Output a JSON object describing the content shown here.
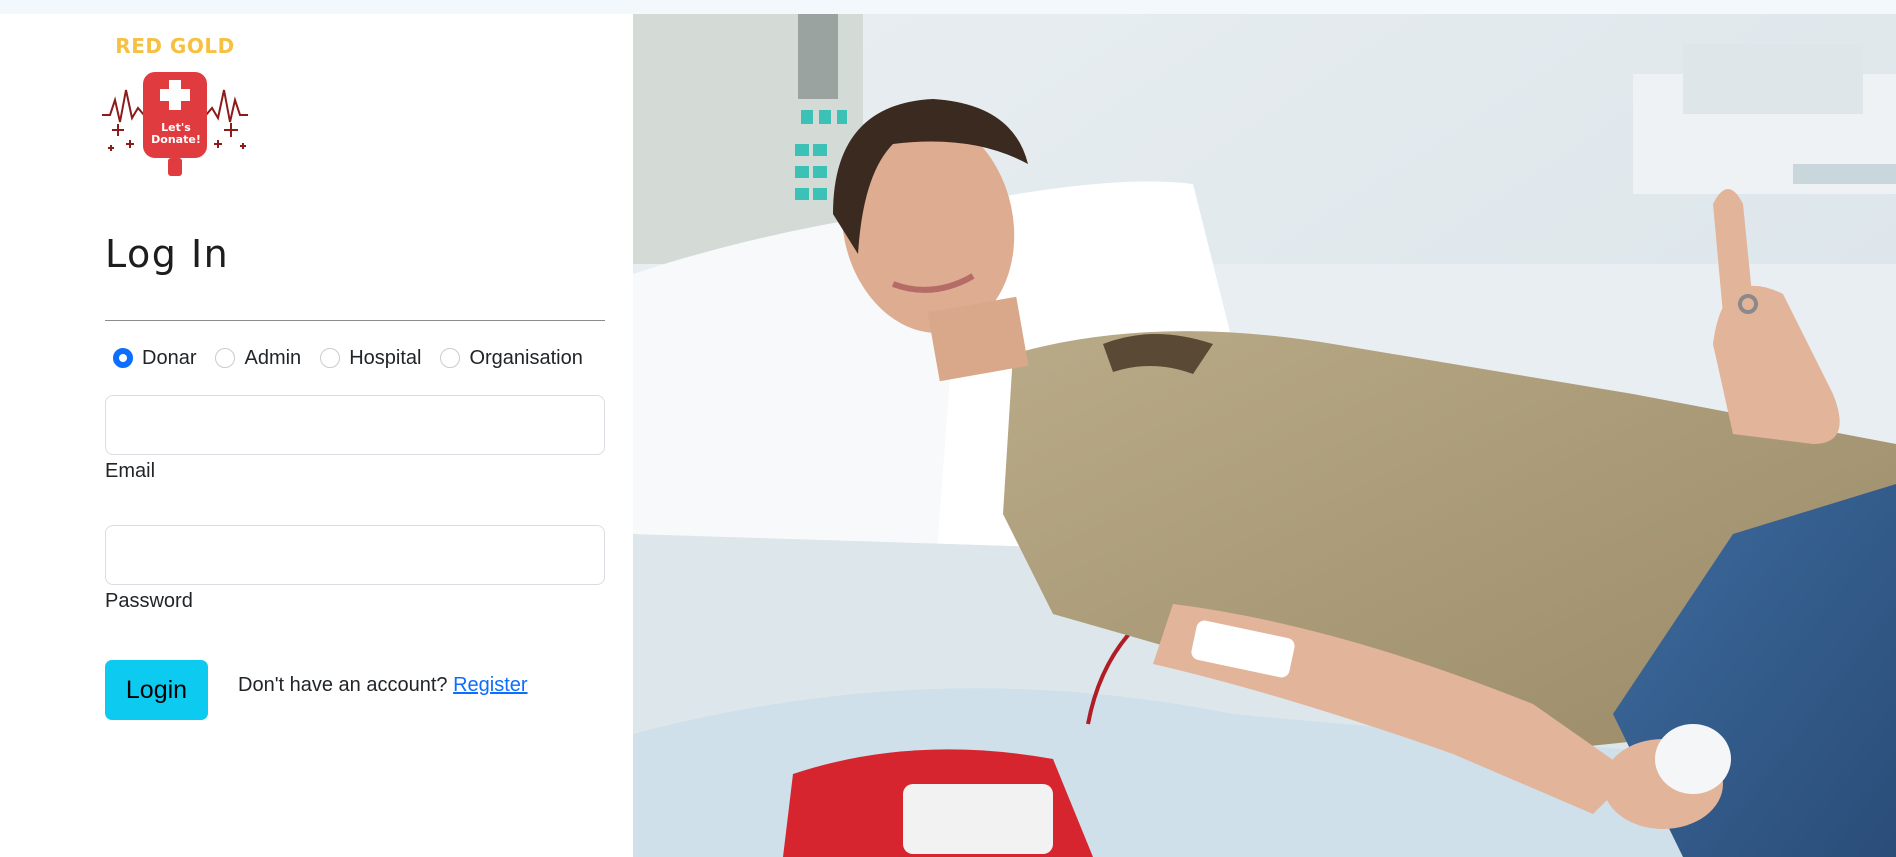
{
  "brand": {
    "name": "RED GOLD",
    "tagline": "Let's Donate!",
    "colors": {
      "gold": "#f6c143",
      "red": "#e03b3f",
      "dark_red": "#8c1c1c"
    }
  },
  "form": {
    "title": "Log In",
    "roles": [
      {
        "label": "Donar",
        "checked": true
      },
      {
        "label": "Admin",
        "checked": false
      },
      {
        "label": "Hospital",
        "checked": false
      },
      {
        "label": "Organisation",
        "checked": false
      }
    ],
    "email": {
      "label": "Email",
      "value": ""
    },
    "password": {
      "label": "Password",
      "value": ""
    },
    "login_label": "Login",
    "register_prompt": "Don't have an account?",
    "register_link": "Register"
  },
  "colors": {
    "primary": "#0d6efd",
    "login_button": "#0dcaf0"
  },
  "hero_image": {
    "icon": "blood-donor-photo"
  }
}
